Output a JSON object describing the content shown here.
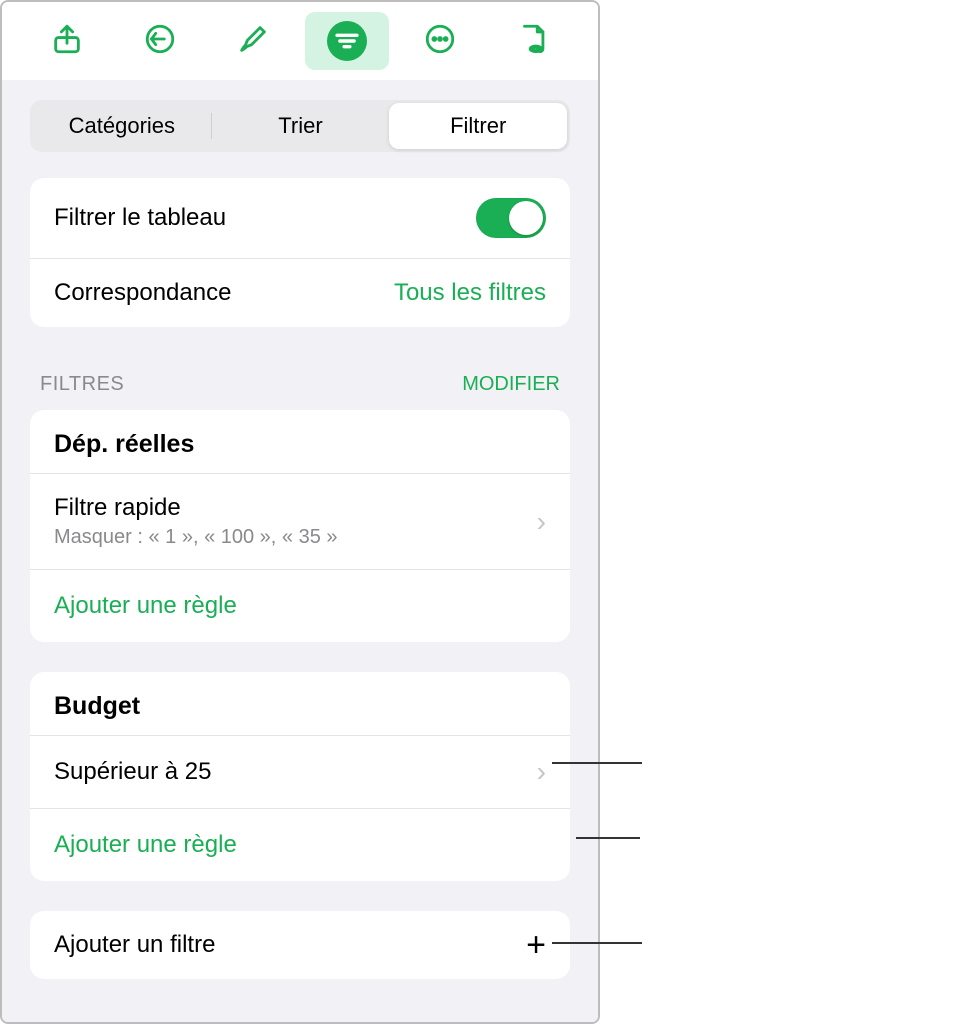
{
  "segmented": {
    "categories": "Catégories",
    "sort": "Trier",
    "filter": "Filtrer"
  },
  "topCard": {
    "filterTableLabel": "Filtrer le tableau",
    "matchLabel": "Correspondance",
    "matchValue": "Tous les filtres"
  },
  "sectionHeader": {
    "label": "FILTRES",
    "action": "MODIFIER"
  },
  "group1": {
    "title": "Dép. réelles",
    "ruleTitle": "Filtre rapide",
    "ruleSub": "Masquer : « 1 », « 100 », « 35 »",
    "addRule": "Ajouter une règle"
  },
  "group2": {
    "title": "Budget",
    "ruleTitle": "Supérieur à 25",
    "addRule": "Ajouter une règle"
  },
  "addFilter": {
    "label": "Ajouter un filtre"
  }
}
